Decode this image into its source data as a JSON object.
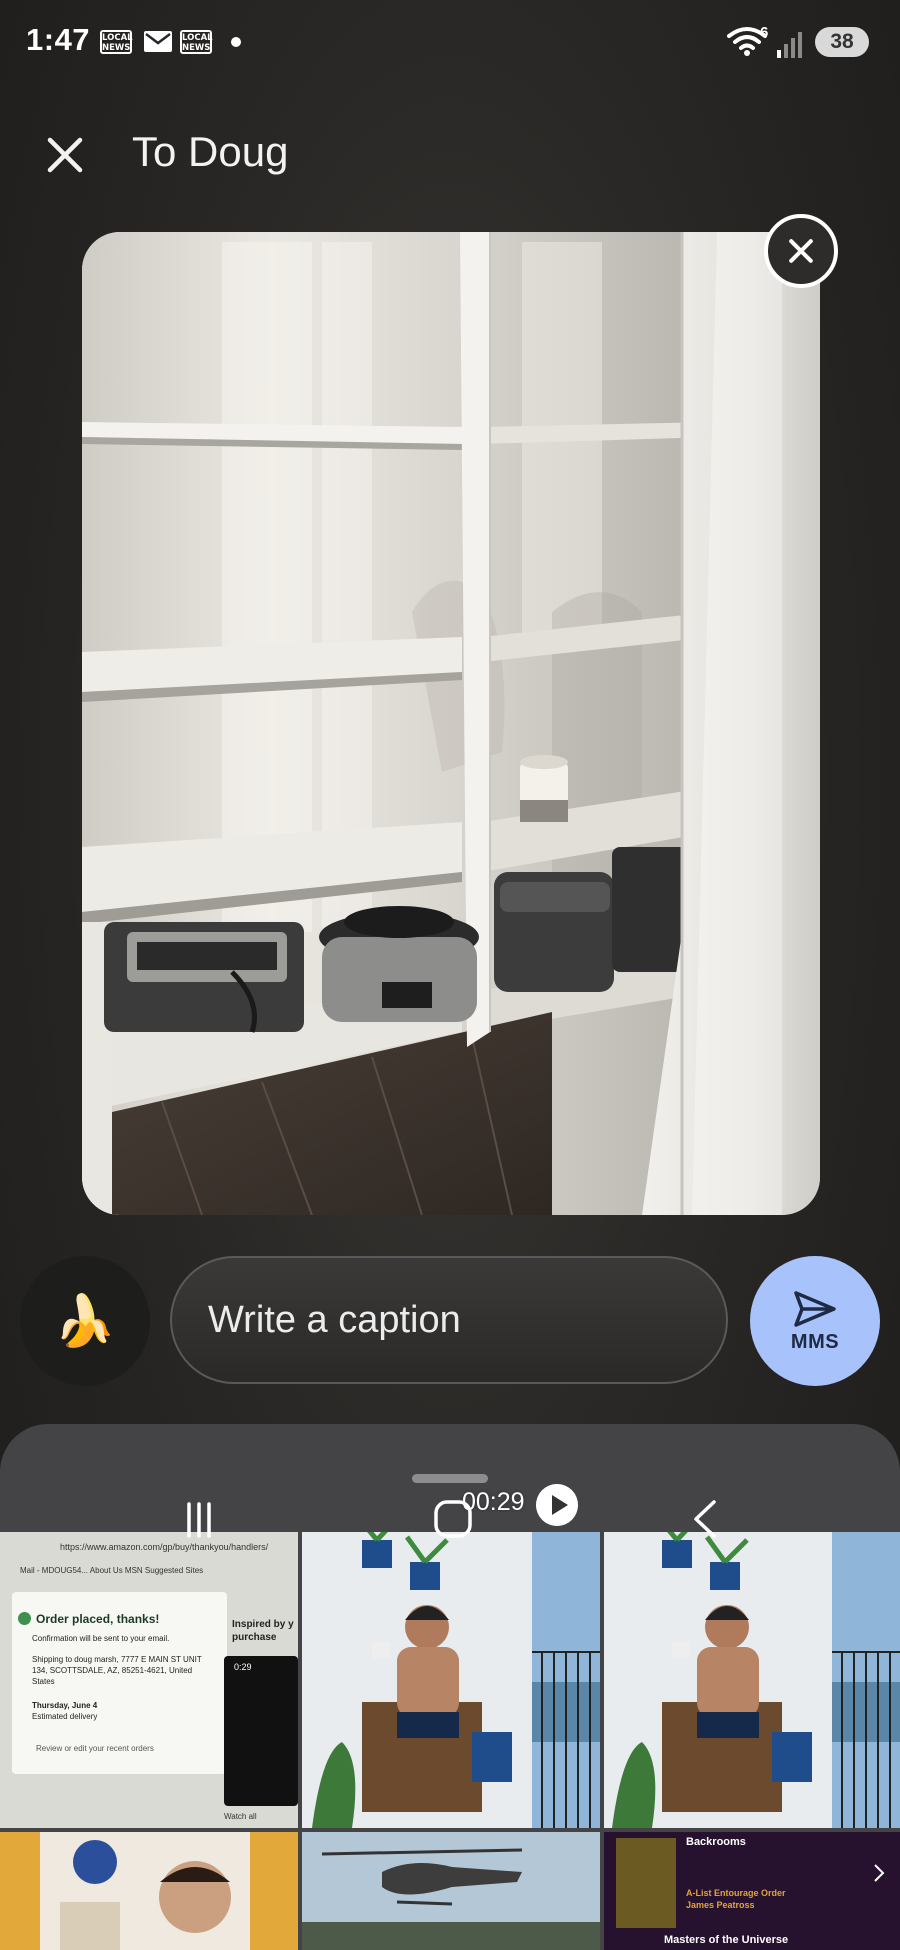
{
  "status_bar": {
    "time": "1:47",
    "news_badge_1": "LOCAL NEWS",
    "news_badge_2": "LOCAL NEWS",
    "wifi_label": "6",
    "battery": "38"
  },
  "header": {
    "title": "To Doug"
  },
  "composer": {
    "emoji": "🍌",
    "caption_placeholder": "Write a caption",
    "send_label": "MMS"
  },
  "gallery": {
    "amazon": {
      "url": "https://www.amazon.com/gp/buy/thankyou/handlers/",
      "tabs": "Mail - MDOUG54...   About Us   MSN   Suggested Sites",
      "title": "Order placed, thanks!",
      "confirmation": "Confirmation will be sent to your email.",
      "shipping": "Shipping to doug marsh, 7777 E MAIN ST UNIT 134, SCOTTSDALE, AZ, 85251-4621, United States",
      "delivery_date": "Thursday, June 4",
      "delivery_label": "Estimated delivery",
      "review": "Review or edit your recent orders",
      "inspired": "Inspired by y purchase",
      "video_time": "0:29",
      "watch_all": "Watch all"
    },
    "video_duration": "00:29",
    "book": {
      "title": "Backrooms",
      "line1": "A-List Entourage Order",
      "line2": "James Peatross",
      "bottom": "Masters of the Universe"
    }
  },
  "colors": {
    "send_button": "#a8c3fb",
    "sheet": "#444446",
    "accent_text": "#e0a43a"
  }
}
